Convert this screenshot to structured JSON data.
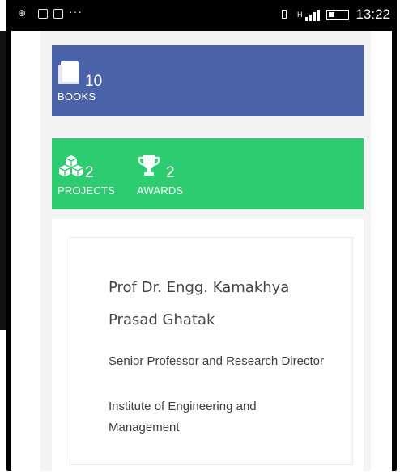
{
  "status_bar": {
    "left_icons": [
      "carrier-icon",
      "image-icon",
      "mail-icon"
    ],
    "more": "···",
    "network_label": "H",
    "time": "13:22"
  },
  "stats": {
    "books": {
      "value": "10",
      "label": "BOOKS"
    },
    "projects": {
      "value": "2",
      "label": "PROJECTS"
    },
    "awards": {
      "value": "2",
      "label": "AWARDS"
    }
  },
  "profile": {
    "name": "Prof Dr. Engg. Kamakhya Prasad Ghatak",
    "title": "Senior Professor and Research Director",
    "organization": "Institute of Engineering and Management"
  },
  "colors": {
    "books_card": "#4a63a8",
    "projects_card": "#2ecc71",
    "page_background": "#f4f4f4",
    "text": "#444444"
  }
}
